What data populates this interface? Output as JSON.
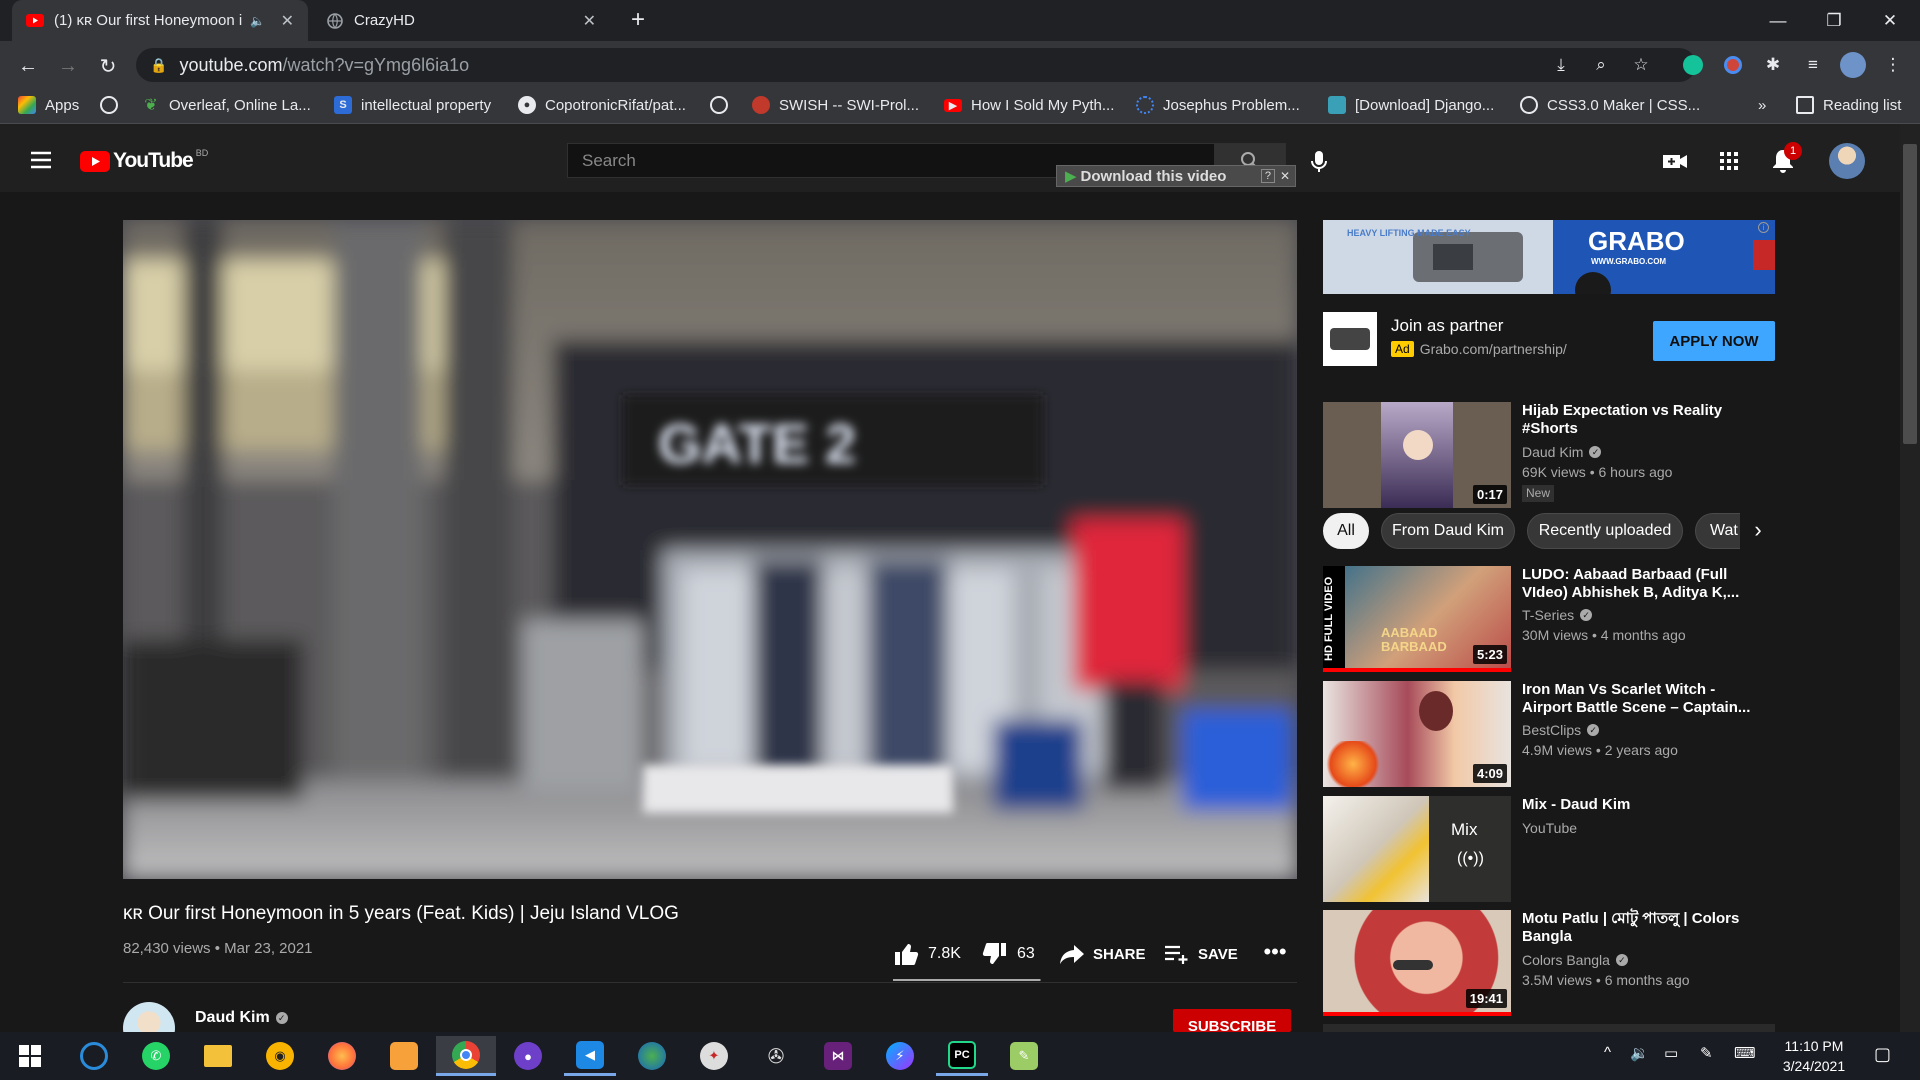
{
  "browser": {
    "tabs": [
      {
        "label": "(1) ᴋʀ Our first Honeymoon i",
        "active": true
      },
      {
        "label": "CrazyHD",
        "active": false
      }
    ],
    "new_tab": "+",
    "url_host": "youtube.com",
    "url_path": "/watch?v=gYmg6l6ia1o",
    "bookmarks": [
      "Apps",
      "Overleaf, Online La...",
      "intellectual property",
      "CopotronicRifat/pat...",
      "SWISH -- SWI-Prol...",
      "How I Sold My Pyth...",
      "Josephus Problem...",
      "[Download] Django...",
      "CSS3.0 Maker | CSS..."
    ],
    "bookmarks_overflow": "»",
    "reading_list": "Reading list"
  },
  "youtube": {
    "logo_text": "YouTube",
    "country_code": "BD",
    "search_placeholder": "Search",
    "download_bar": "Download this video",
    "notification_count": "1"
  },
  "video": {
    "title": "ᴋʀ Our first Honeymoon in 5 years (Feat. Kids) | Jeju Island VLOG",
    "views_date": "82,430 views • Mar 23, 2021",
    "likes": "7.8K",
    "dislikes": "63",
    "share": "SHARE",
    "save": "SAVE",
    "like_ratio": 0.992,
    "channel": "Daud Kim",
    "subscribe": "SUBSCRIBE",
    "scene_sign": "GATE 2"
  },
  "ad": {
    "banner_brand": "GRABO",
    "banner_url": "WWW.GRABO.COM",
    "banner_tagline": "HEAVY LIFTING MADE EASY",
    "title": "Join as partner",
    "badge": "Ad",
    "domain": "Grabo.com/partnership/",
    "cta": "APPLY NOW"
  },
  "chips": [
    "All",
    "From Daud Kim",
    "Recently uploaded",
    "Wat"
  ],
  "recommendations": [
    {
      "title": "Hijab Expectation vs Reality #Shorts",
      "channel": "Daud Kim",
      "verified": true,
      "meta": "69K views • 6 hours ago",
      "badge": "New",
      "duration": "0:17"
    },
    {
      "title": "LUDO: Aabaad Barbaad (Full VIdeo) Abhishek B, Aditya K,...",
      "channel": "T-Series",
      "verified": true,
      "meta": "30M views • 4 months ago",
      "duration": "5:23",
      "thumb_caption": "HD FULL VIDEO",
      "thumb_title": "AABAAD BARBAAD"
    },
    {
      "title": "Iron Man Vs Scarlet Witch - Airport Battle Scene – Captain...",
      "channel": "BestClips",
      "verified": true,
      "meta": "4.9M views • 2 years ago",
      "duration": "4:09"
    },
    {
      "title": "Mix - Daud Kim",
      "channel": "YouTube",
      "verified": false,
      "meta": "",
      "mix_label": "Mix"
    },
    {
      "title": "Motu Patlu | মোটু পাতলু | Colors Bangla",
      "channel": "Colors Bangla",
      "verified": true,
      "meta": "3.5M views • 6 months ago",
      "duration": "19:41"
    }
  ],
  "taskbar": {
    "time": "11:10 PM",
    "date": "3/24/2021"
  },
  "colors": {
    "yt_red": "#ff0000",
    "apply_blue": "#3ea6ff",
    "ad_badge": "#ffcc00",
    "progress_red": "#ff0000"
  }
}
